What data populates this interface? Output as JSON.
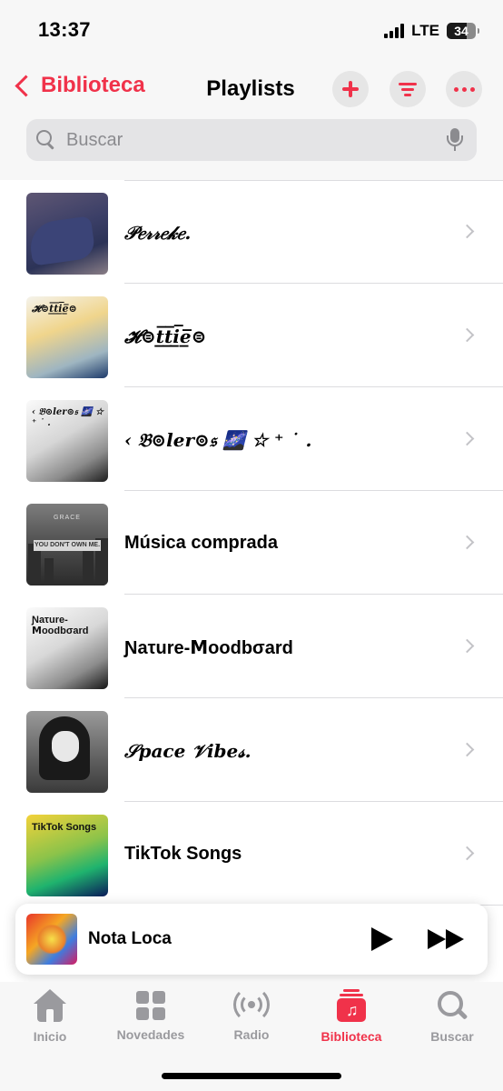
{
  "status": {
    "time": "13:37",
    "network": "LTE",
    "battery": "34"
  },
  "nav": {
    "back_label": "Biblioteca",
    "title": "Playlists"
  },
  "search": {
    "placeholder": "Buscar"
  },
  "playlists": [
    {
      "name": "𝒫𝑒𝓇𝓇𝑒𝓀𝑒.",
      "art_text": ""
    },
    {
      "name": "𝓗⊜t̲̅t̲̅i̲̅e̲̅⊜",
      "art_text": "𝓗⊜t̲̅t̲̅i̲̅e̲̅⊜"
    },
    {
      "name": "‹ 𝔅⊚ler⊚𝔰 🌌 ☆ ⁺ ˙ .",
      "art_text": "‹ 𝔅⊚ler⊚𝔰 🌌 ☆ ⁺ ˙ ."
    },
    {
      "name": "Música comprada",
      "art_text": "YOU DON'T OWN ME.",
      "art_subtext": "GRACE"
    },
    {
      "name": "Ɲaτurе-Ⅿoodbσard",
      "art_text": "Ɲaτurе-Ⅿoodbσard"
    },
    {
      "name": "𝒮pace 𝒱ibe𝓈.",
      "art_text": ""
    },
    {
      "name": "TikTok Songs",
      "art_text": "TikTok Songs"
    }
  ],
  "now_playing": {
    "title": "Nota Loca"
  },
  "tabs": [
    {
      "label": "Inicio",
      "icon": "home-icon",
      "active": false
    },
    {
      "label": "Novedades",
      "icon": "grid-icon",
      "active": false
    },
    {
      "label": "Radio",
      "icon": "radio-icon",
      "active": false
    },
    {
      "label": "Biblioteca",
      "icon": "library-icon",
      "active": true
    },
    {
      "label": "Buscar",
      "icon": "search-icon",
      "active": false
    }
  ],
  "colors": {
    "accent": "#f0324a",
    "inactive": "#9a9a9e",
    "background": "#ffffff"
  }
}
